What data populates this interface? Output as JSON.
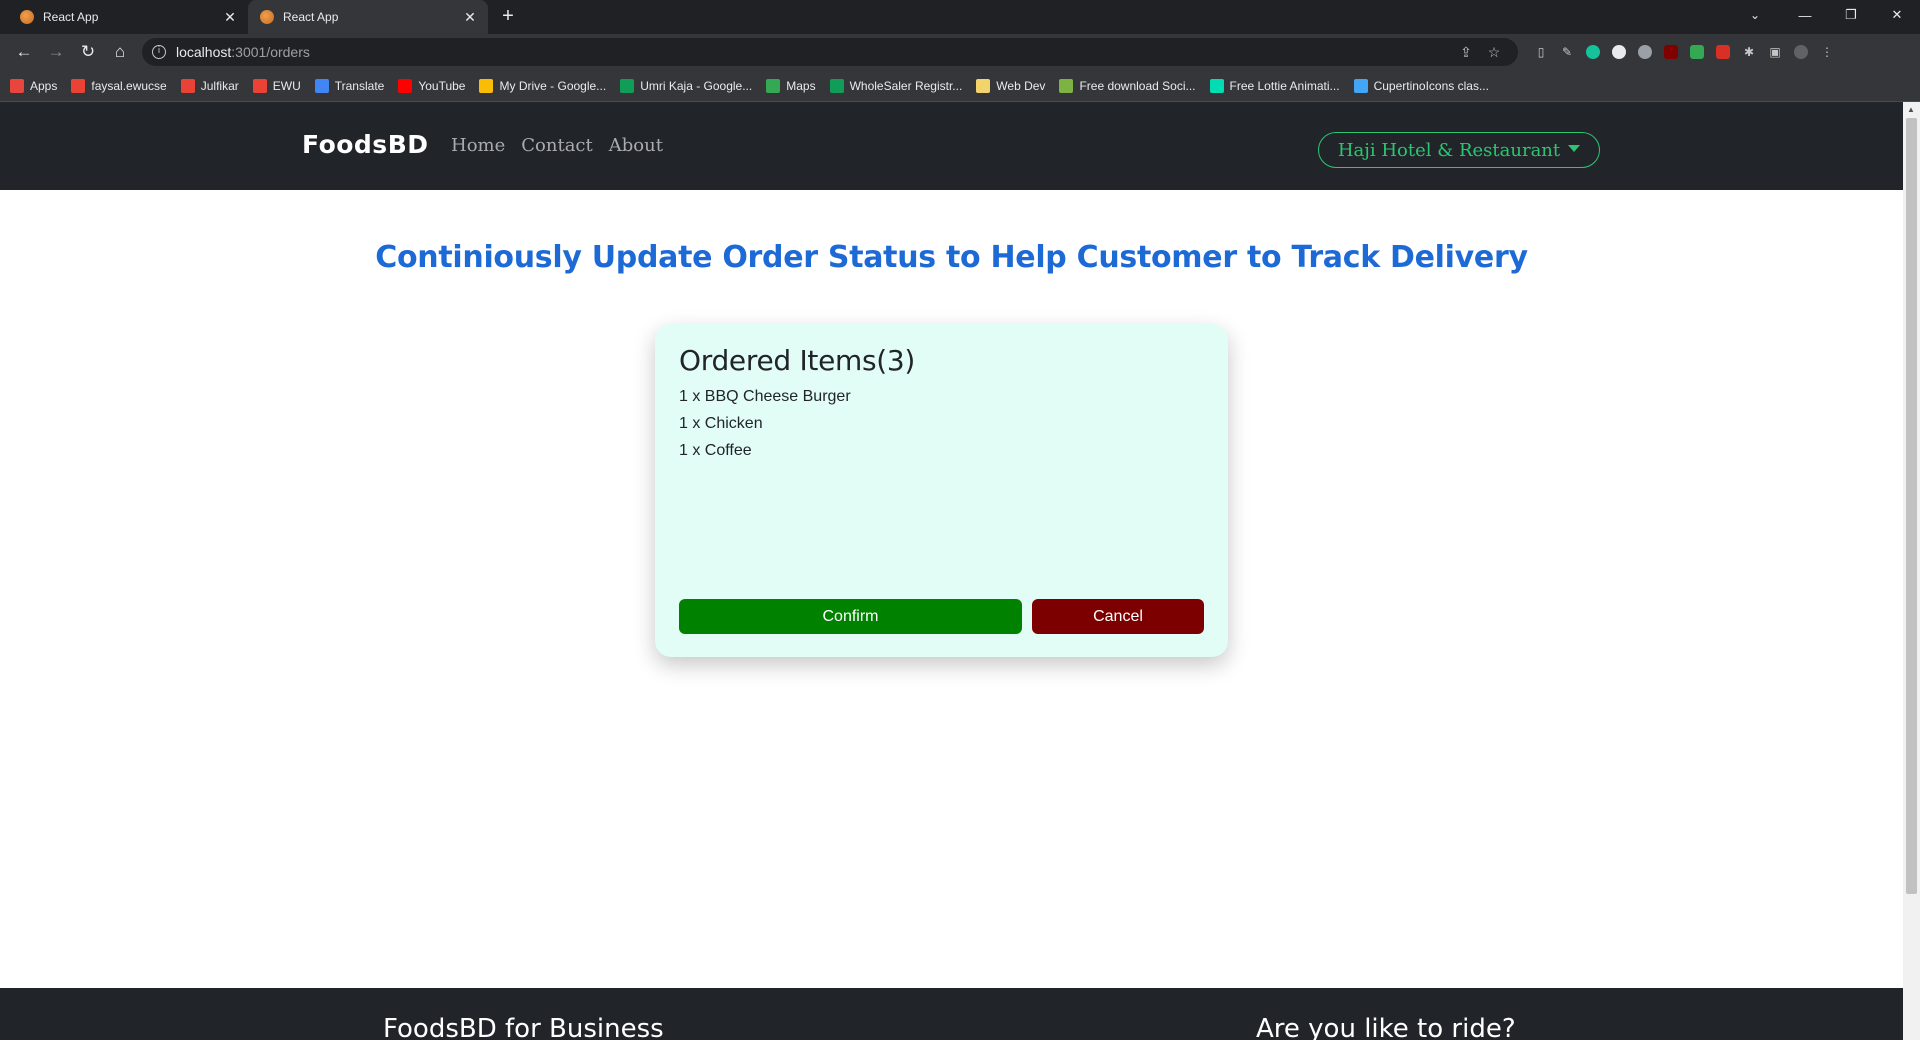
{
  "browser": {
    "tabs": [
      {
        "title": "React App",
        "active": false
      },
      {
        "title": "React App",
        "active": true
      }
    ],
    "new_tab_glyph": "+",
    "close_glyph": "✕",
    "address": {
      "host": "localhost",
      "path": ":3001/orders"
    },
    "bookmarks": [
      {
        "label": "Apps",
        "icon": "apps-grid-icon",
        "color": "#e8453c"
      },
      {
        "label": "faysal.ewucse",
        "icon": "gmail-icon",
        "color": "#ea4335"
      },
      {
        "label": "Julfikar",
        "icon": "gmail-icon",
        "color": "#ea4335"
      },
      {
        "label": "EWU",
        "icon": "gmail-icon",
        "color": "#ea4335"
      },
      {
        "label": "Translate",
        "icon": "translate-icon",
        "color": "#4285f4"
      },
      {
        "label": "YouTube",
        "icon": "youtube-icon",
        "color": "#ff0000"
      },
      {
        "label": "My Drive - Google...",
        "icon": "drive-icon",
        "color": "#fbbc04"
      },
      {
        "label": "Umri Kaja - Google...",
        "icon": "sheets-icon",
        "color": "#0f9d58"
      },
      {
        "label": "Maps",
        "icon": "maps-icon",
        "color": "#34a853"
      },
      {
        "label": "WholeSaler Registr...",
        "icon": "sheets-icon",
        "color": "#0f9d58"
      },
      {
        "label": "Web Dev",
        "icon": "folder-icon",
        "color": "#f3d36b"
      },
      {
        "label": "Free download Soci...",
        "icon": "leaf-icon",
        "color": "#7cb342"
      },
      {
        "label": "Free Lottie Animati...",
        "icon": "lottie-icon",
        "color": "#00ddb3"
      },
      {
        "label": "CupertinoIcons clas...",
        "icon": "flutter-icon",
        "color": "#42a5f5"
      }
    ]
  },
  "site": {
    "brand": "FoodsBD",
    "nav": [
      "Home",
      "Contact",
      "About"
    ],
    "restaurant": "Haji Hotel & Restaurant"
  },
  "headline": "Continiously Update Order Status to Help Customer to Track Delivery",
  "order": {
    "heading": "Ordered Items(3)",
    "items": [
      "1 x BBQ Cheese Burger",
      "1 x Chicken",
      "1 x Coffee"
    ],
    "confirm_label": "Confirm",
    "cancel_label": "Cancel"
  },
  "footer": {
    "left_title": "FoodsBD for Business",
    "right_title": "Are you like to ride?"
  },
  "colors": {
    "accent_blue": "#1d6ad6",
    "accent_green": "#2cc672",
    "confirm": "#008200",
    "cancel": "#7d0000",
    "card_bg": "#e2fdf6",
    "nav_bg": "#212529"
  }
}
